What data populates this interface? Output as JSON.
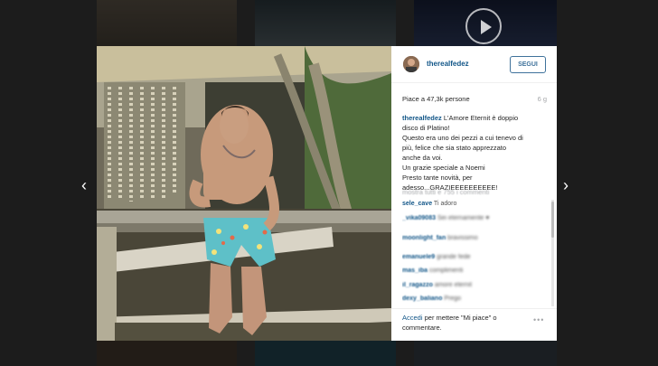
{
  "post": {
    "username": "therealfedez",
    "follow_label": "SEGUI",
    "likes": "Piace a 47,3k persone",
    "time": "6 g",
    "caption_author": "therealfedez",
    "caption_first": " L'Amore Eternit è doppio",
    "caption_lines": [
      "disco di Platino!",
      "Questo era uno dei pezzi a cui tenevo di",
      "più, felice che sia stato apprezzato",
      "anche da voi.",
      "Un grazie speciale a Noemi",
      "Presto tante novità, per",
      "adesso...GRAZIEEEEEEEEEE!"
    ],
    "show_all": "mostra tutti e 755 i commenti",
    "comments": [
      {
        "user": "sele_cave",
        "text": "Ti adoro"
      },
      {
        "user": "_vika09083",
        "text": "Sei eternamente ♥"
      },
      {
        "user": "moonlight_fan",
        "text": "bravissimo"
      },
      {
        "user": "emanuele9",
        "text": "grande fede"
      },
      {
        "user": "mas_iba",
        "text": "complimenti"
      },
      {
        "user": "il_ragazzo",
        "text": "amore eternit"
      },
      {
        "user": "dexy_baliano",
        "text": "Prego"
      }
    ]
  },
  "footer": {
    "login_link": "Accedi",
    "login_rest": " per mettere \"Mi piace\" o commentare.",
    "more_label": "•••"
  },
  "nav": {
    "prev_arrow": "‹",
    "next_arrow": "›"
  },
  "icons": {
    "play": "play-icon",
    "avatar": "avatar-image"
  }
}
